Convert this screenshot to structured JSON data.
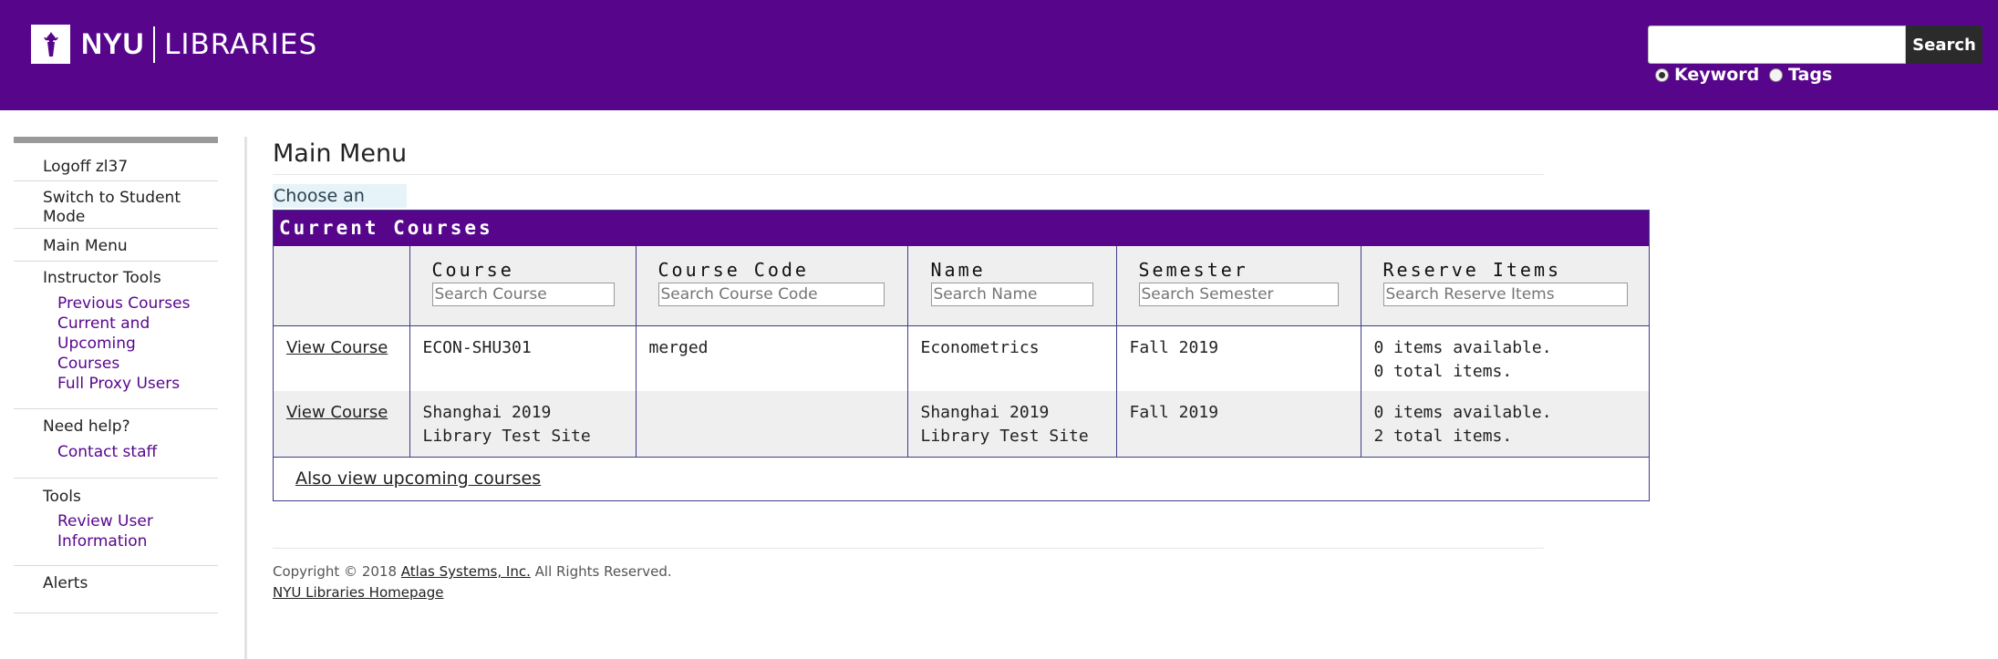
{
  "header": {
    "logo_nyu": "NYU",
    "logo_libraries": "LIBRARIES",
    "search_value": "",
    "search_button": "Search",
    "radio_keyword": "Keyword",
    "radio_tags": "Tags",
    "brand_color": "#57068c"
  },
  "sidebar": {
    "logoff": "Logoff zl37",
    "switch_mode": "Switch to Student Mode",
    "main_menu": "Main Menu",
    "instructor_tools": "Instructor Tools",
    "previous_courses": "Previous Courses",
    "current_upcoming": "Current and Upcoming Courses",
    "full_proxy": "Full Proxy Users",
    "need_help": "Need help?",
    "contact_staff": "Contact staff",
    "tools": "Tools",
    "review_user": "Review User Information",
    "alerts": "Alerts"
  },
  "main": {
    "title": "Main Menu",
    "instruction": "Choose an option from the choices below.",
    "table_title": "Current Courses",
    "columns": [
      {
        "label": "Course",
        "placeholder": "Search Course"
      },
      {
        "label": "Course Code",
        "placeholder": "Search Course Code"
      },
      {
        "label": "Name",
        "placeholder": "Search Name"
      },
      {
        "label": "Semester",
        "placeholder": "Search Semester"
      },
      {
        "label": "Reserve Items",
        "placeholder": "Search Reserve Items"
      }
    ],
    "rows": [
      {
        "action": "View Course",
        "course": "ECON-SHU301",
        "code": "merged",
        "name": "Econometrics",
        "semester": "Fall 2019",
        "available": "0 items available.",
        "total": "0 total items."
      },
      {
        "action": "View Course",
        "course": "Shanghai 2019 Library Test Site",
        "code": "",
        "name": "Shanghai 2019 Library Test Site",
        "semester": "Fall 2019",
        "available": "0 items available.",
        "total": "2 total items."
      }
    ],
    "also_view": "Also view upcoming courses"
  },
  "footer": {
    "copyright_prefix": "Copyright © 2018",
    "atlas_link": "Atlas Systems, Inc.",
    "rights": "All Rights Reserved.",
    "homepage_link": "NYU Libraries Homepage"
  }
}
